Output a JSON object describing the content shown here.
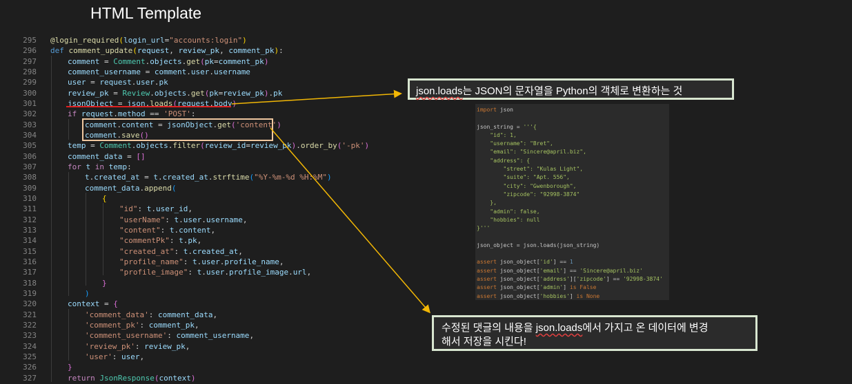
{
  "title": "HTML Template",
  "code_lines": [
    {
      "n": "295",
      "indent": 0,
      "tokens": [
        [
          "fn",
          "@login_required"
        ],
        [
          "br1",
          "("
        ],
        [
          "var",
          "login_url"
        ],
        [
          "",
          "="
        ],
        [
          "str",
          "\"accounts:login\""
        ],
        [
          "br1",
          ")"
        ]
      ]
    },
    {
      "n": "296",
      "indent": 0,
      "tokens": [
        [
          "kw",
          "def "
        ],
        [
          "fn",
          "comment_update"
        ],
        [
          "br1",
          "("
        ],
        [
          "var",
          "request"
        ],
        [
          "",
          ", "
        ],
        [
          "var",
          "review_pk"
        ],
        [
          "",
          ", "
        ],
        [
          "var",
          "comment_pk"
        ],
        [
          "br1",
          ")"
        ],
        [
          "",
          ":"
        ]
      ]
    },
    {
      "n": "297",
      "indent": 1,
      "tokens": [
        [
          "var",
          "comment"
        ],
        [
          "",
          " = "
        ],
        [
          "cls",
          "Comment"
        ],
        [
          "",
          "."
        ],
        [
          "var",
          "objects"
        ],
        [
          "",
          "."
        ],
        [
          "fn",
          "get"
        ],
        [
          "br2",
          "("
        ],
        [
          "var",
          "pk"
        ],
        [
          "",
          "="
        ],
        [
          "var",
          "comment_pk"
        ],
        [
          "br2",
          ")"
        ]
      ]
    },
    {
      "n": "298",
      "indent": 1,
      "tokens": [
        [
          "var",
          "comment_username"
        ],
        [
          "",
          " = "
        ],
        [
          "var",
          "comment"
        ],
        [
          "",
          "."
        ],
        [
          "var",
          "user"
        ],
        [
          "",
          "."
        ],
        [
          "var",
          "username"
        ]
      ]
    },
    {
      "n": "299",
      "indent": 1,
      "tokens": [
        [
          "var",
          "user"
        ],
        [
          "",
          " = "
        ],
        [
          "var",
          "request"
        ],
        [
          "",
          "."
        ],
        [
          "var",
          "user"
        ],
        [
          "",
          "."
        ],
        [
          "var",
          "pk"
        ]
      ]
    },
    {
      "n": "300",
      "indent": 1,
      "tokens": [
        [
          "var",
          "review_pk"
        ],
        [
          "",
          " = "
        ],
        [
          "cls",
          "Review"
        ],
        [
          "",
          "."
        ],
        [
          "var",
          "objects"
        ],
        [
          "",
          "."
        ],
        [
          "fn",
          "get"
        ],
        [
          "br2",
          "("
        ],
        [
          "var",
          "pk"
        ],
        [
          "",
          "="
        ],
        [
          "var",
          "review_pk"
        ],
        [
          "br2",
          ")"
        ],
        [
          "",
          "."
        ],
        [
          "var",
          "pk"
        ]
      ]
    },
    {
      "n": "301",
      "indent": 1,
      "tokens": [
        [
          "var",
          "jsonObject"
        ],
        [
          "",
          " = "
        ],
        [
          "var",
          "json"
        ],
        [
          "",
          "."
        ],
        [
          "fn",
          "loads"
        ],
        [
          "br2",
          "("
        ],
        [
          "var",
          "request"
        ],
        [
          "",
          "."
        ],
        [
          "var",
          "body"
        ],
        [
          "br2",
          ")"
        ]
      ]
    },
    {
      "n": "302",
      "indent": 1,
      "tokens": [
        [
          "kw2",
          "if "
        ],
        [
          "var",
          "request"
        ],
        [
          "",
          "."
        ],
        [
          "var",
          "method"
        ],
        [
          "",
          " == "
        ],
        [
          "str",
          "'POST'"
        ],
        [
          "",
          ":"
        ]
      ]
    },
    {
      "n": "303",
      "indent": 2,
      "tokens": [
        [
          "var",
          "comment"
        ],
        [
          "",
          "."
        ],
        [
          "var",
          "content"
        ],
        [
          "",
          " = "
        ],
        [
          "var",
          "jsonObject"
        ],
        [
          "",
          "."
        ],
        [
          "fn",
          "get"
        ],
        [
          "br2",
          "("
        ],
        [
          "str",
          "'content'"
        ],
        [
          "br2",
          ")"
        ]
      ]
    },
    {
      "n": "304",
      "indent": 2,
      "tokens": [
        [
          "var",
          "comment"
        ],
        [
          "",
          "."
        ],
        [
          "fn",
          "save"
        ],
        [
          "br2",
          "()"
        ]
      ]
    },
    {
      "n": "305",
      "indent": 1,
      "tokens": [
        [
          "var",
          "temp"
        ],
        [
          "",
          " = "
        ],
        [
          "cls",
          "Comment"
        ],
        [
          "",
          "."
        ],
        [
          "var",
          "objects"
        ],
        [
          "",
          "."
        ],
        [
          "fn",
          "filter"
        ],
        [
          "br2",
          "("
        ],
        [
          "var",
          "review_id"
        ],
        [
          "",
          "="
        ],
        [
          "var",
          "review_pk"
        ],
        [
          "br2",
          ")"
        ],
        [
          "",
          "."
        ],
        [
          "fn",
          "order_by"
        ],
        [
          "br2",
          "("
        ],
        [
          "str",
          "'-pk'"
        ],
        [
          "br2",
          ")"
        ]
      ]
    },
    {
      "n": "306",
      "indent": 1,
      "tokens": [
        [
          "var",
          "comment_data"
        ],
        [
          "",
          " = "
        ],
        [
          "br2",
          "[]"
        ]
      ]
    },
    {
      "n": "307",
      "indent": 1,
      "tokens": [
        [
          "kw2",
          "for "
        ],
        [
          "var",
          "t"
        ],
        [
          "kw2",
          " in "
        ],
        [
          "var",
          "temp"
        ],
        [
          "",
          ":"
        ]
      ]
    },
    {
      "n": "308",
      "indent": 2,
      "tokens": [
        [
          "var",
          "t"
        ],
        [
          "",
          "."
        ],
        [
          "var",
          "created_at"
        ],
        [
          "",
          " = "
        ],
        [
          "var",
          "t"
        ],
        [
          "",
          "."
        ],
        [
          "var",
          "created_at"
        ],
        [
          "",
          "."
        ],
        [
          "fn",
          "strftime"
        ],
        [
          "br3",
          "("
        ],
        [
          "str",
          "\"%Y-%m-%d %H:%M\""
        ],
        [
          "br3",
          ")"
        ]
      ]
    },
    {
      "n": "309",
      "indent": 2,
      "tokens": [
        [
          "var",
          "comment_data"
        ],
        [
          "",
          "."
        ],
        [
          "fn",
          "append"
        ],
        [
          "br3",
          "("
        ]
      ]
    },
    {
      "n": "310",
      "indent": 3,
      "tokens": [
        [
          "br1",
          "{"
        ]
      ]
    },
    {
      "n": "311",
      "indent": 4,
      "tokens": [
        [
          "str",
          "\"id\""
        ],
        [
          "",
          ": "
        ],
        [
          "var",
          "t"
        ],
        [
          "",
          "."
        ],
        [
          "var",
          "user_id"
        ],
        [
          "",
          ","
        ]
      ]
    },
    {
      "n": "312",
      "indent": 4,
      "tokens": [
        [
          "str",
          "\"userName\""
        ],
        [
          "",
          ": "
        ],
        [
          "var",
          "t"
        ],
        [
          "",
          "."
        ],
        [
          "var",
          "user"
        ],
        [
          "",
          "."
        ],
        [
          "var",
          "username"
        ],
        [
          "",
          ","
        ]
      ]
    },
    {
      "n": "313",
      "indent": 4,
      "tokens": [
        [
          "str",
          "\"content\""
        ],
        [
          "",
          ": "
        ],
        [
          "var",
          "t"
        ],
        [
          "",
          "."
        ],
        [
          "var",
          "content"
        ],
        [
          "",
          ","
        ]
      ]
    },
    {
      "n": "314",
      "indent": 4,
      "tokens": [
        [
          "str",
          "\"commentPk\""
        ],
        [
          "",
          ": "
        ],
        [
          "var",
          "t"
        ],
        [
          "",
          "."
        ],
        [
          "var",
          "pk"
        ],
        [
          "",
          ","
        ]
      ]
    },
    {
      "n": "315",
      "indent": 4,
      "tokens": [
        [
          "str",
          "\"created_at\""
        ],
        [
          "",
          ": "
        ],
        [
          "var",
          "t"
        ],
        [
          "",
          "."
        ],
        [
          "var",
          "created_at"
        ],
        [
          "",
          ","
        ]
      ]
    },
    {
      "n": "316",
      "indent": 4,
      "tokens": [
        [
          "str",
          "\"profile_name\""
        ],
        [
          "",
          ": "
        ],
        [
          "var",
          "t"
        ],
        [
          "",
          "."
        ],
        [
          "var",
          "user"
        ],
        [
          "",
          "."
        ],
        [
          "var",
          "profile_name"
        ],
        [
          "",
          ","
        ]
      ]
    },
    {
      "n": "317",
      "indent": 4,
      "tokens": [
        [
          "str",
          "\"profile_image\""
        ],
        [
          "",
          ": "
        ],
        [
          "var",
          "t"
        ],
        [
          "",
          "."
        ],
        [
          "var",
          "user"
        ],
        [
          "",
          "."
        ],
        [
          "var",
          "profile_image"
        ],
        [
          "",
          "."
        ],
        [
          "var",
          "url"
        ],
        [
          "",
          ","
        ]
      ]
    },
    {
      "n": "318",
      "indent": 3,
      "tokens": [
        [
          "br2",
          "}"
        ]
      ]
    },
    {
      "n": "319",
      "indent": 2,
      "tokens": [
        [
          "br3",
          ")"
        ]
      ]
    },
    {
      "n": "320",
      "indent": 1,
      "tokens": [
        [
          "var",
          "context"
        ],
        [
          "",
          " = "
        ],
        [
          "br2",
          "{"
        ]
      ]
    },
    {
      "n": "321",
      "indent": 2,
      "tokens": [
        [
          "str",
          "'comment_data'"
        ],
        [
          "",
          ": "
        ],
        [
          "var",
          "comment_data"
        ],
        [
          "",
          ","
        ]
      ]
    },
    {
      "n": "322",
      "indent": 2,
      "tokens": [
        [
          "str",
          "'comment_pk'"
        ],
        [
          "",
          ": "
        ],
        [
          "var",
          "comment_pk"
        ],
        [
          "",
          ","
        ]
      ]
    },
    {
      "n": "323",
      "indent": 2,
      "tokens": [
        [
          "str",
          "'comment_username'"
        ],
        [
          "",
          ": "
        ],
        [
          "var",
          "comment_username"
        ],
        [
          "",
          ","
        ]
      ]
    },
    {
      "n": "324",
      "indent": 2,
      "tokens": [
        [
          "str",
          "'review_pk'"
        ],
        [
          "",
          ": "
        ],
        [
          "var",
          "review_pk"
        ],
        [
          "",
          ","
        ]
      ]
    },
    {
      "n": "325",
      "indent": 2,
      "tokens": [
        [
          "str",
          "'user'"
        ],
        [
          "",
          ": "
        ],
        [
          "var",
          "user"
        ],
        [
          "",
          ","
        ]
      ]
    },
    {
      "n": "326",
      "indent": 1,
      "tokens": [
        [
          "br2",
          "}"
        ]
      ]
    },
    {
      "n": "327",
      "indent": 1,
      "tokens": [
        [
          "kw2",
          "return "
        ],
        [
          "cls",
          "JsonResponse"
        ],
        [
          "br2",
          "("
        ],
        [
          "var",
          "context"
        ],
        [
          "br2",
          ")"
        ]
      ]
    }
  ],
  "note1": {
    "prefix": "json.loads",
    "text": "는 JSON의 문자열을 Python의 객체로 변환하는 것"
  },
  "note2": {
    "line1_pre": "수정된 댓글의 내용을 ",
    "line1_link": "json.loads",
    "line1_post": "에서 가지고 온 데이터에 변경",
    "line2": "해서 저장을 시킨다!"
  },
  "snippet_lines": [
    [
      [
        "k",
        "import"
      ],
      [
        "",
        " json"
      ]
    ],
    [],
    [
      [
        "",
        "json_string = "
      ],
      [
        "t",
        "'''{"
      ]
    ],
    [
      [
        "t",
        "    \"id\": 1,"
      ]
    ],
    [
      [
        "t",
        "    \"username\": \"Bret\","
      ]
    ],
    [
      [
        "t",
        "    \"email\": \"Sincere@april.biz\","
      ]
    ],
    [
      [
        "t",
        "    \"address\": {"
      ]
    ],
    [
      [
        "t",
        "        \"street\": \"Kulas Light\","
      ]
    ],
    [
      [
        "t",
        "        \"suite\": \"Apt. 556\","
      ]
    ],
    [
      [
        "t",
        "        \"city\": \"Gwenborough\","
      ]
    ],
    [
      [
        "t",
        "        \"zipcode\": \"92998-3874\""
      ]
    ],
    [
      [
        "t",
        "    },"
      ]
    ],
    [
      [
        "t",
        "    \"admin\": false,"
      ]
    ],
    [
      [
        "t",
        "    \"hobbies\": null"
      ]
    ],
    [
      [
        "t",
        "}'''"
      ]
    ],
    [],
    [
      [
        "",
        "json_object = json.loads(json_string)"
      ]
    ],
    [],
    [
      [
        "k",
        "assert"
      ],
      [
        "",
        " json_object["
      ],
      [
        "t",
        "'id'"
      ],
      [
        "",
        "] == "
      ],
      [
        "n",
        "1"
      ]
    ],
    [
      [
        "k",
        "assert"
      ],
      [
        "",
        " json_object["
      ],
      [
        "t",
        "'email'"
      ],
      [
        "",
        "] == "
      ],
      [
        "t",
        "'Sincere@april.biz'"
      ]
    ],
    [
      [
        "k",
        "assert"
      ],
      [
        "",
        " json_object["
      ],
      [
        "t",
        "'address'"
      ],
      [
        "",
        "]["
      ],
      [
        "t",
        "'zipcode'"
      ],
      [
        "",
        "] == "
      ],
      [
        "t",
        "'92998-3874'"
      ]
    ],
    [
      [
        "k",
        "assert"
      ],
      [
        "",
        " json_object["
      ],
      [
        "t",
        "'admin'"
      ],
      [
        "",
        "] "
      ],
      [
        "k",
        "is False"
      ]
    ],
    [
      [
        "k",
        "assert"
      ],
      [
        "",
        " json_object["
      ],
      [
        "t",
        "'hobbies'"
      ],
      [
        "",
        "] "
      ],
      [
        "k",
        "is None"
      ]
    ]
  ]
}
